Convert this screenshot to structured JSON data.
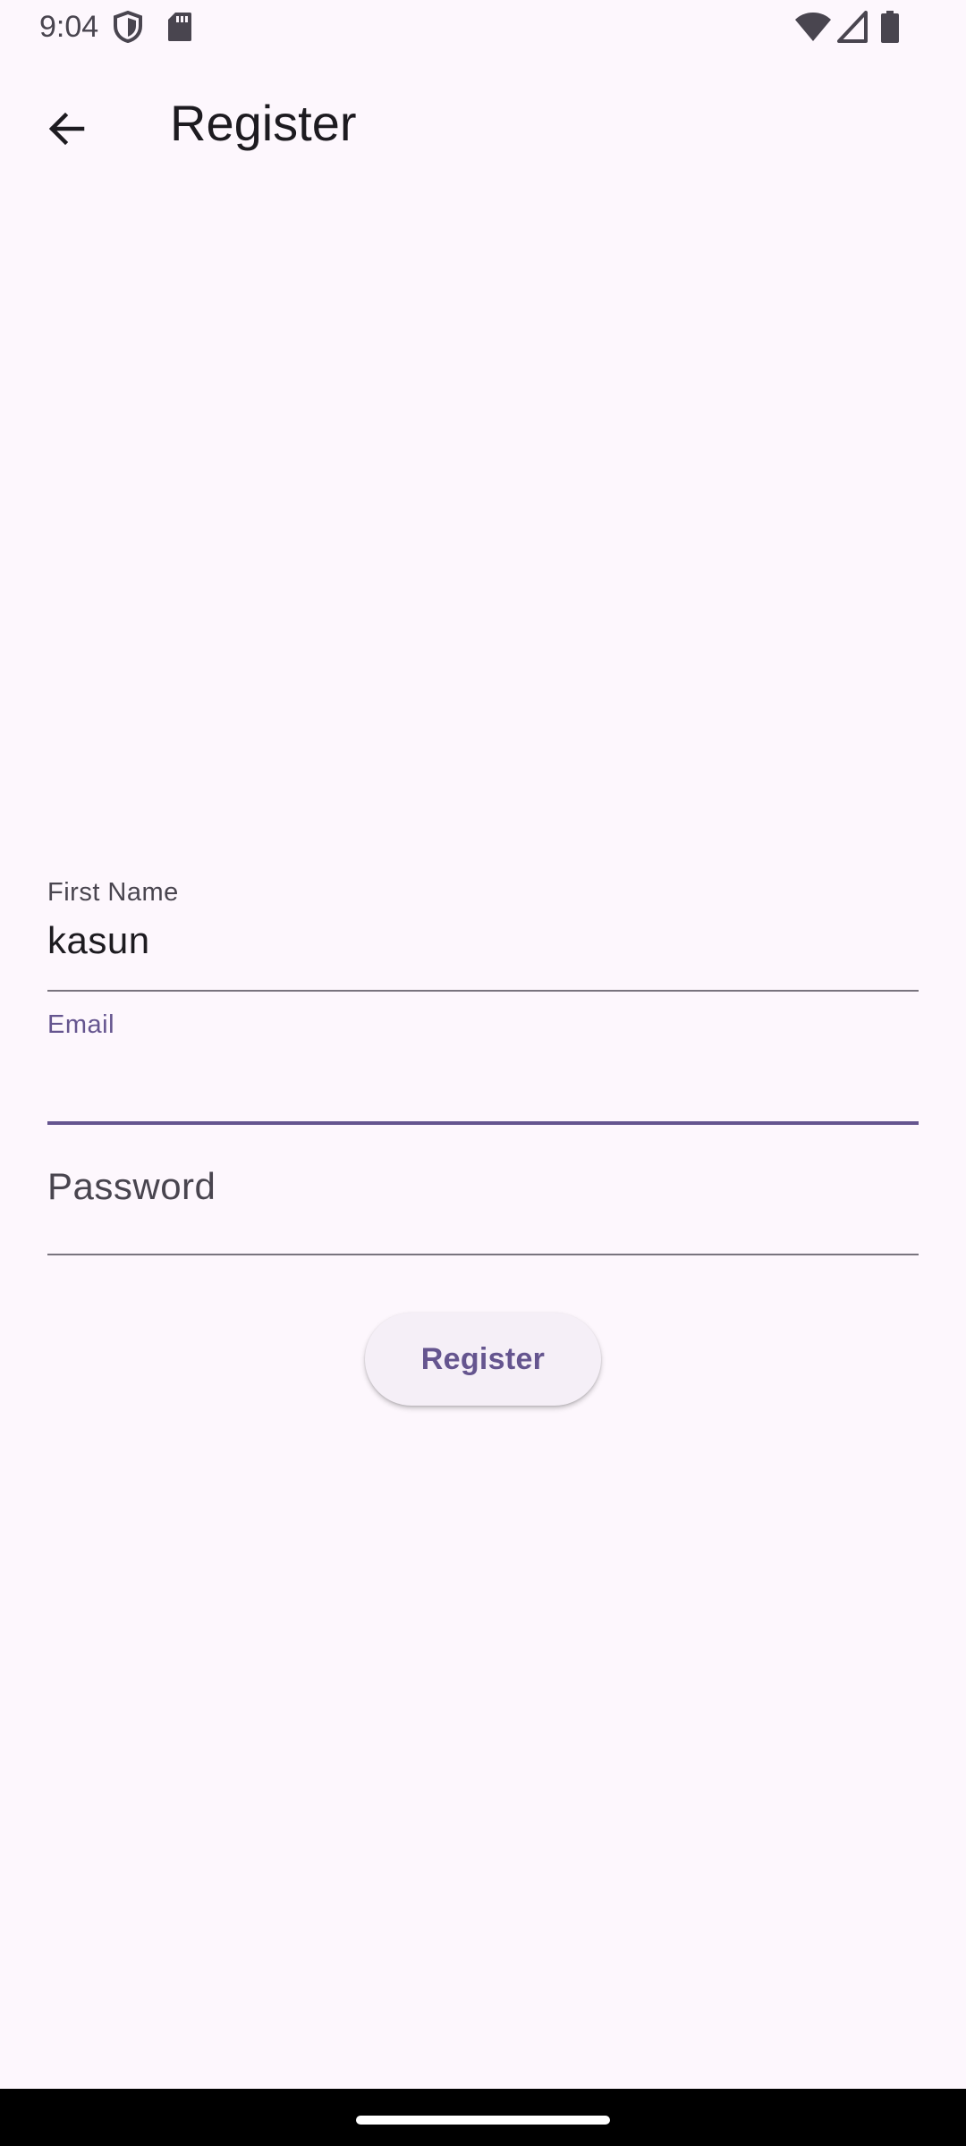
{
  "status_bar": {
    "time": "9:04",
    "icons": [
      "shield-icon",
      "sd-card-icon",
      "wifi-icon",
      "signal-icon",
      "battery-icon"
    ]
  },
  "app_bar": {
    "back_icon": "arrow-back-icon",
    "title": "Register"
  },
  "form": {
    "first_name": {
      "label": "First Name",
      "value": "kasun"
    },
    "email": {
      "label": "Email",
      "value": ""
    },
    "password": {
      "label": "Password",
      "value": ""
    },
    "submit_label": "Register"
  },
  "colors": {
    "background": "#FDF7FD",
    "primary": "#65558F",
    "text": "#1D1B20",
    "label": "#49454F",
    "button_bg": "#F5EFF7"
  }
}
